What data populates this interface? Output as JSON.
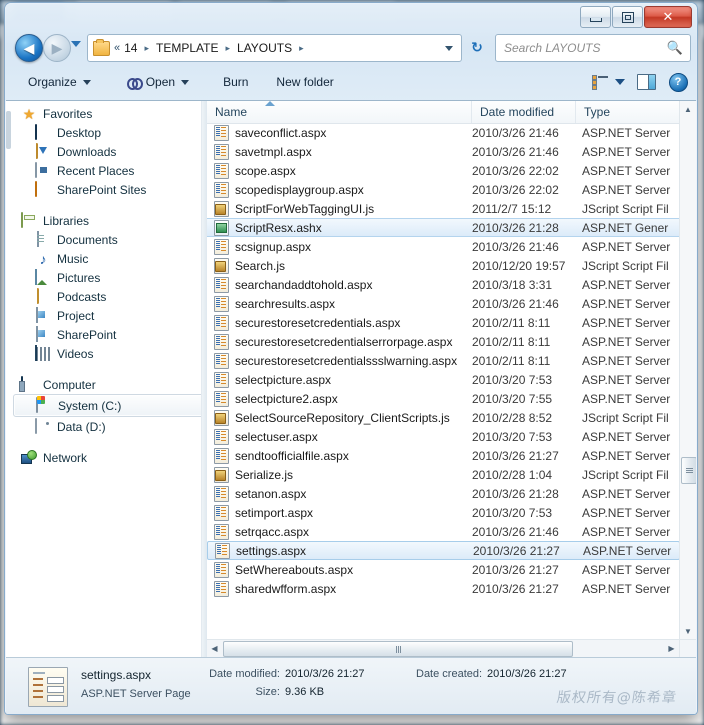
{
  "window": {
    "controls": {
      "minimize": "minimize",
      "maximize": "maximize",
      "close": "✕"
    }
  },
  "address": {
    "back_glyph": "◀",
    "forward_glyph": "▶",
    "breadcrumbs": [
      "«",
      "14",
      "TEMPLATE",
      "LAYOUTS"
    ],
    "separator": "▸",
    "refresh_glyph": "↻"
  },
  "search": {
    "placeholder": "Search LAYOUTS",
    "icon": "search-icon"
  },
  "toolbar": {
    "organize": "Organize",
    "open": "Open",
    "burn": "Burn",
    "new_folder": "New folder",
    "help_glyph": "?"
  },
  "sidebar": {
    "groups": [
      {
        "label": "Favorites",
        "icon": "star-icon",
        "items": [
          {
            "label": "Desktop",
            "icon": "desktop-icon"
          },
          {
            "label": "Downloads",
            "icon": "downloads-icon"
          },
          {
            "label": "Recent Places",
            "icon": "recent-places-icon"
          },
          {
            "label": "SharePoint Sites",
            "icon": "sharepoint-sites-icon"
          }
        ]
      },
      {
        "label": "Libraries",
        "icon": "libraries-icon",
        "items": [
          {
            "label": "Documents",
            "icon": "documents-icon"
          },
          {
            "label": "Music",
            "icon": "music-icon"
          },
          {
            "label": "Pictures",
            "icon": "pictures-icon"
          },
          {
            "label": "Podcasts",
            "icon": "podcasts-icon"
          },
          {
            "label": "Project",
            "icon": "project-icon"
          },
          {
            "label": "SharePoint",
            "icon": "sharepoint-icon"
          },
          {
            "label": "Videos",
            "icon": "videos-icon"
          }
        ]
      },
      {
        "label": "Computer",
        "icon": "computer-icon",
        "items": [
          {
            "label": "System (C:)",
            "icon": "system-drive-icon",
            "selected": true
          },
          {
            "label": "Data (D:)",
            "icon": "drive-icon"
          }
        ]
      },
      {
        "label": "Network",
        "icon": "network-icon",
        "items": []
      }
    ]
  },
  "filelist": {
    "columns": [
      {
        "key": "name",
        "label": "Name",
        "sorted": "asc"
      },
      {
        "key": "date",
        "label": "Date modified"
      },
      {
        "key": "type",
        "label": "Type"
      }
    ],
    "rows": [
      {
        "name": "saveconflict.aspx",
        "date": "2010/3/26 21:46",
        "type": "ASP.NET Server",
        "icon": "aspx-file-icon"
      },
      {
        "name": "savetmpl.aspx",
        "date": "2010/3/26 21:46",
        "type": "ASP.NET Server",
        "icon": "aspx-file-icon"
      },
      {
        "name": "scope.aspx",
        "date": "2010/3/26 22:02",
        "type": "ASP.NET Server",
        "icon": "aspx-file-icon"
      },
      {
        "name": "scopedisplaygroup.aspx",
        "date": "2010/3/26 22:02",
        "type": "ASP.NET Server",
        "icon": "aspx-file-icon"
      },
      {
        "name": "ScriptForWebTaggingUI.js",
        "date": "2011/2/7 15:12",
        "type": "JScript Script Fil",
        "icon": "js-file-icon"
      },
      {
        "name": "ScriptResx.ashx",
        "date": "2010/3/26 21:28",
        "type": "ASP.NET Gener",
        "icon": "ashx-file-icon",
        "highlighted": true
      },
      {
        "name": "scsignup.aspx",
        "date": "2010/3/26 21:46",
        "type": "ASP.NET Server",
        "icon": "aspx-file-icon"
      },
      {
        "name": "Search.js",
        "date": "2010/12/20 19:57",
        "type": "JScript Script Fil",
        "icon": "js-file-icon"
      },
      {
        "name": "searchandaddtohold.aspx",
        "date": "2010/3/18 3:31",
        "type": "ASP.NET Server",
        "icon": "aspx-file-icon"
      },
      {
        "name": "searchresults.aspx",
        "date": "2010/3/26 21:46",
        "type": "ASP.NET Server",
        "icon": "aspx-file-icon"
      },
      {
        "name": "securestoresetcredentials.aspx",
        "date": "2010/2/11 8:11",
        "type": "ASP.NET Server",
        "icon": "aspx-file-icon"
      },
      {
        "name": "securestoresetcredentialserrorpage.aspx",
        "date": "2010/2/11 8:11",
        "type": "ASP.NET Server",
        "icon": "aspx-file-icon"
      },
      {
        "name": "securestoresetcredentialssslwarning.aspx",
        "date": "2010/2/11 8:11",
        "type": "ASP.NET Server",
        "icon": "aspx-file-icon"
      },
      {
        "name": "selectpicture.aspx",
        "date": "2010/3/20 7:53",
        "type": "ASP.NET Server",
        "icon": "aspx-file-icon"
      },
      {
        "name": "selectpicture2.aspx",
        "date": "2010/3/20 7:55",
        "type": "ASP.NET Server",
        "icon": "aspx-file-icon"
      },
      {
        "name": "SelectSourceRepository_ClientScripts.js",
        "date": "2010/2/28 8:52",
        "type": "JScript Script Fil",
        "icon": "js-file-icon"
      },
      {
        "name": "selectuser.aspx",
        "date": "2010/3/20 7:53",
        "type": "ASP.NET Server",
        "icon": "aspx-file-icon"
      },
      {
        "name": "sendtoofficialfile.aspx",
        "date": "2010/3/26 21:27",
        "type": "ASP.NET Server",
        "icon": "aspx-file-icon"
      },
      {
        "name": "Serialize.js",
        "date": "2010/2/28 1:04",
        "type": "JScript Script Fil",
        "icon": "js-file-icon"
      },
      {
        "name": "setanon.aspx",
        "date": "2010/3/26 21:28",
        "type": "ASP.NET Server",
        "icon": "aspx-file-icon"
      },
      {
        "name": "setimport.aspx",
        "date": "2010/3/20 7:53",
        "type": "ASP.NET Server",
        "icon": "aspx-file-icon"
      },
      {
        "name": "setrqacc.aspx",
        "date": "2010/3/26 21:46",
        "type": "ASP.NET Server",
        "icon": "aspx-file-icon"
      },
      {
        "name": "settings.aspx",
        "date": "2010/3/26 21:27",
        "type": "ASP.NET Server",
        "icon": "aspx-file-icon",
        "selected": true
      },
      {
        "name": "SetWhereabouts.aspx",
        "date": "2010/3/26 21:27",
        "type": "ASP.NET Server",
        "icon": "aspx-file-icon"
      },
      {
        "name": "sharedwfform.aspx",
        "date": "2010/3/26 21:27",
        "type": "ASP.NET Server",
        "icon": "aspx-file-icon"
      }
    ],
    "scroll": {
      "up_glyph": "▲",
      "down_glyph": "▼",
      "left_glyph": "◀",
      "right_glyph": "▶"
    }
  },
  "details_pane": {
    "file_name": "settings.aspx",
    "file_type": "ASP.NET Server Page",
    "date_modified_label": "Date modified:",
    "date_modified_value": "2010/3/26 21:27",
    "date_created_label": "Date created:",
    "date_created_value": "2010/3/26 21:27",
    "size_label": "Size:",
    "size_value": "9.36 KB"
  },
  "watermark": "版权所有@陈希章",
  "colors": {
    "selection": "#dcebf9",
    "selection_border": "#b4d4ee",
    "accent": "#1a74c4",
    "close_button": "#c33724"
  }
}
